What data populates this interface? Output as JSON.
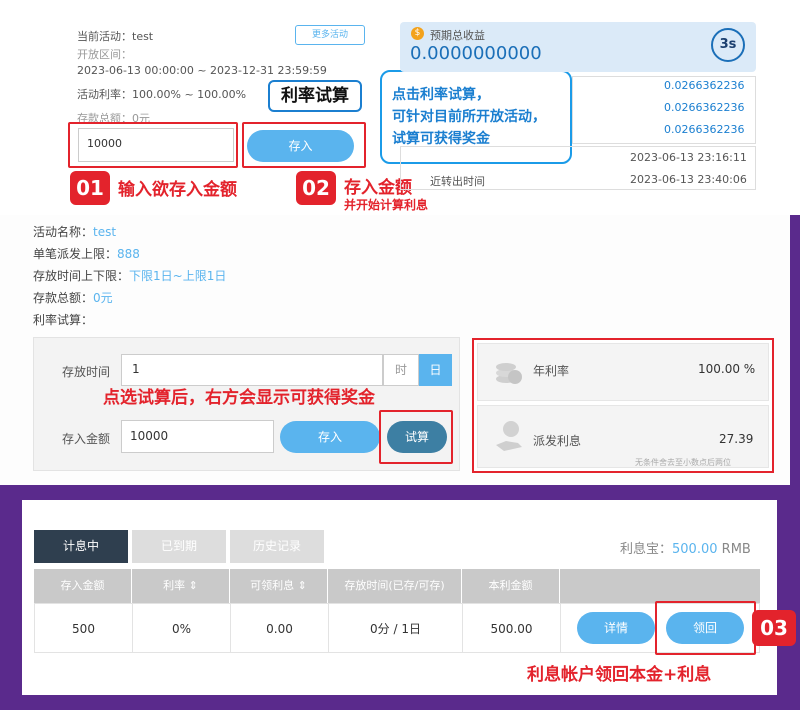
{
  "top": {
    "activity_label": "当前活动：test",
    "more_button": "更多活动",
    "period_label": "开放区间：",
    "period_value": "2023-06-13 00:00:00 ~ 2023-12-31 23:59:59",
    "rate_label": "活动利率：100.00% ~ 100.00%",
    "total_deposit_label": "存款总额：0元",
    "amount_input": "10000",
    "deposit_button": "存入",
    "callout_tag": "利率试算",
    "callout_line1": "点击利率试算，",
    "callout_line2": "可针对目前所开放活动，",
    "callout_line3": "试算可获得奖金",
    "step1_num": "01",
    "step1_text": "输入欲存入金额",
    "step2_num": "02",
    "step2_text": "存入金额",
    "step2_sub": "并开始计算利息",
    "earnings_label": "预期总收益",
    "earnings_value": "0.0000000000",
    "timer": "3s",
    "earn_rows": [
      "0.0266362236",
      "0.0266362236",
      "0.0266362236"
    ],
    "time_rows": [
      {
        "label": "",
        "value": "2023-06-13 23:16:11"
      },
      {
        "label": "近转出时间",
        "value": "2023-06-13 23:40:06"
      }
    ]
  },
  "middle": {
    "activity_name_label": "活动名称：",
    "activity_name_value": "test",
    "single_max_label": "单笔派发上限：",
    "single_max_value": "888",
    "duration_label": "存放时间上下限：",
    "duration_value": "下限1日~上限1日",
    "total_label": "存款总额：",
    "total_value": "0元",
    "calc_label": "利率试算：",
    "form_time_label": "存放时间",
    "form_time_value": "1",
    "unit_hour": "时",
    "unit_day": "日",
    "form_amount_label": "存入金额",
    "form_amount_value": "10000",
    "deposit_button": "存入",
    "calc_button": "试算",
    "overlay_text": "点选试算后，右方会显示可获得奖金",
    "annual_rate_label": "年利率",
    "annual_rate_value": "100.00 %",
    "interest_label": "派发利息",
    "interest_value": "27.39",
    "interest_note": "无条件舍去至小数点后两位"
  },
  "bottom": {
    "tabs": [
      "计息中",
      "已到期",
      "历史记录"
    ],
    "interest_treasure_label": "利息宝：",
    "interest_treasure_value": "500.00",
    "interest_treasure_unit": "RMB",
    "headers": [
      "存入金额",
      "利率 ⇕",
      "可领利息 ⇕",
      "存放时间(已存/可存)",
      "本利金额",
      ""
    ],
    "row": [
      "500",
      "0%",
      "0.00",
      "0分 / 1日",
      "500.00"
    ],
    "details_button": "详情",
    "claim_button": "领回",
    "step3_num": "03",
    "step3_text": "利息帐户领回本金+利息"
  },
  "colors": {
    "accent_red": "#e3232c",
    "blue": "#5ab4ee",
    "purple_bg": "#5a2a8c",
    "dark_tab": "#2f3f4f"
  }
}
